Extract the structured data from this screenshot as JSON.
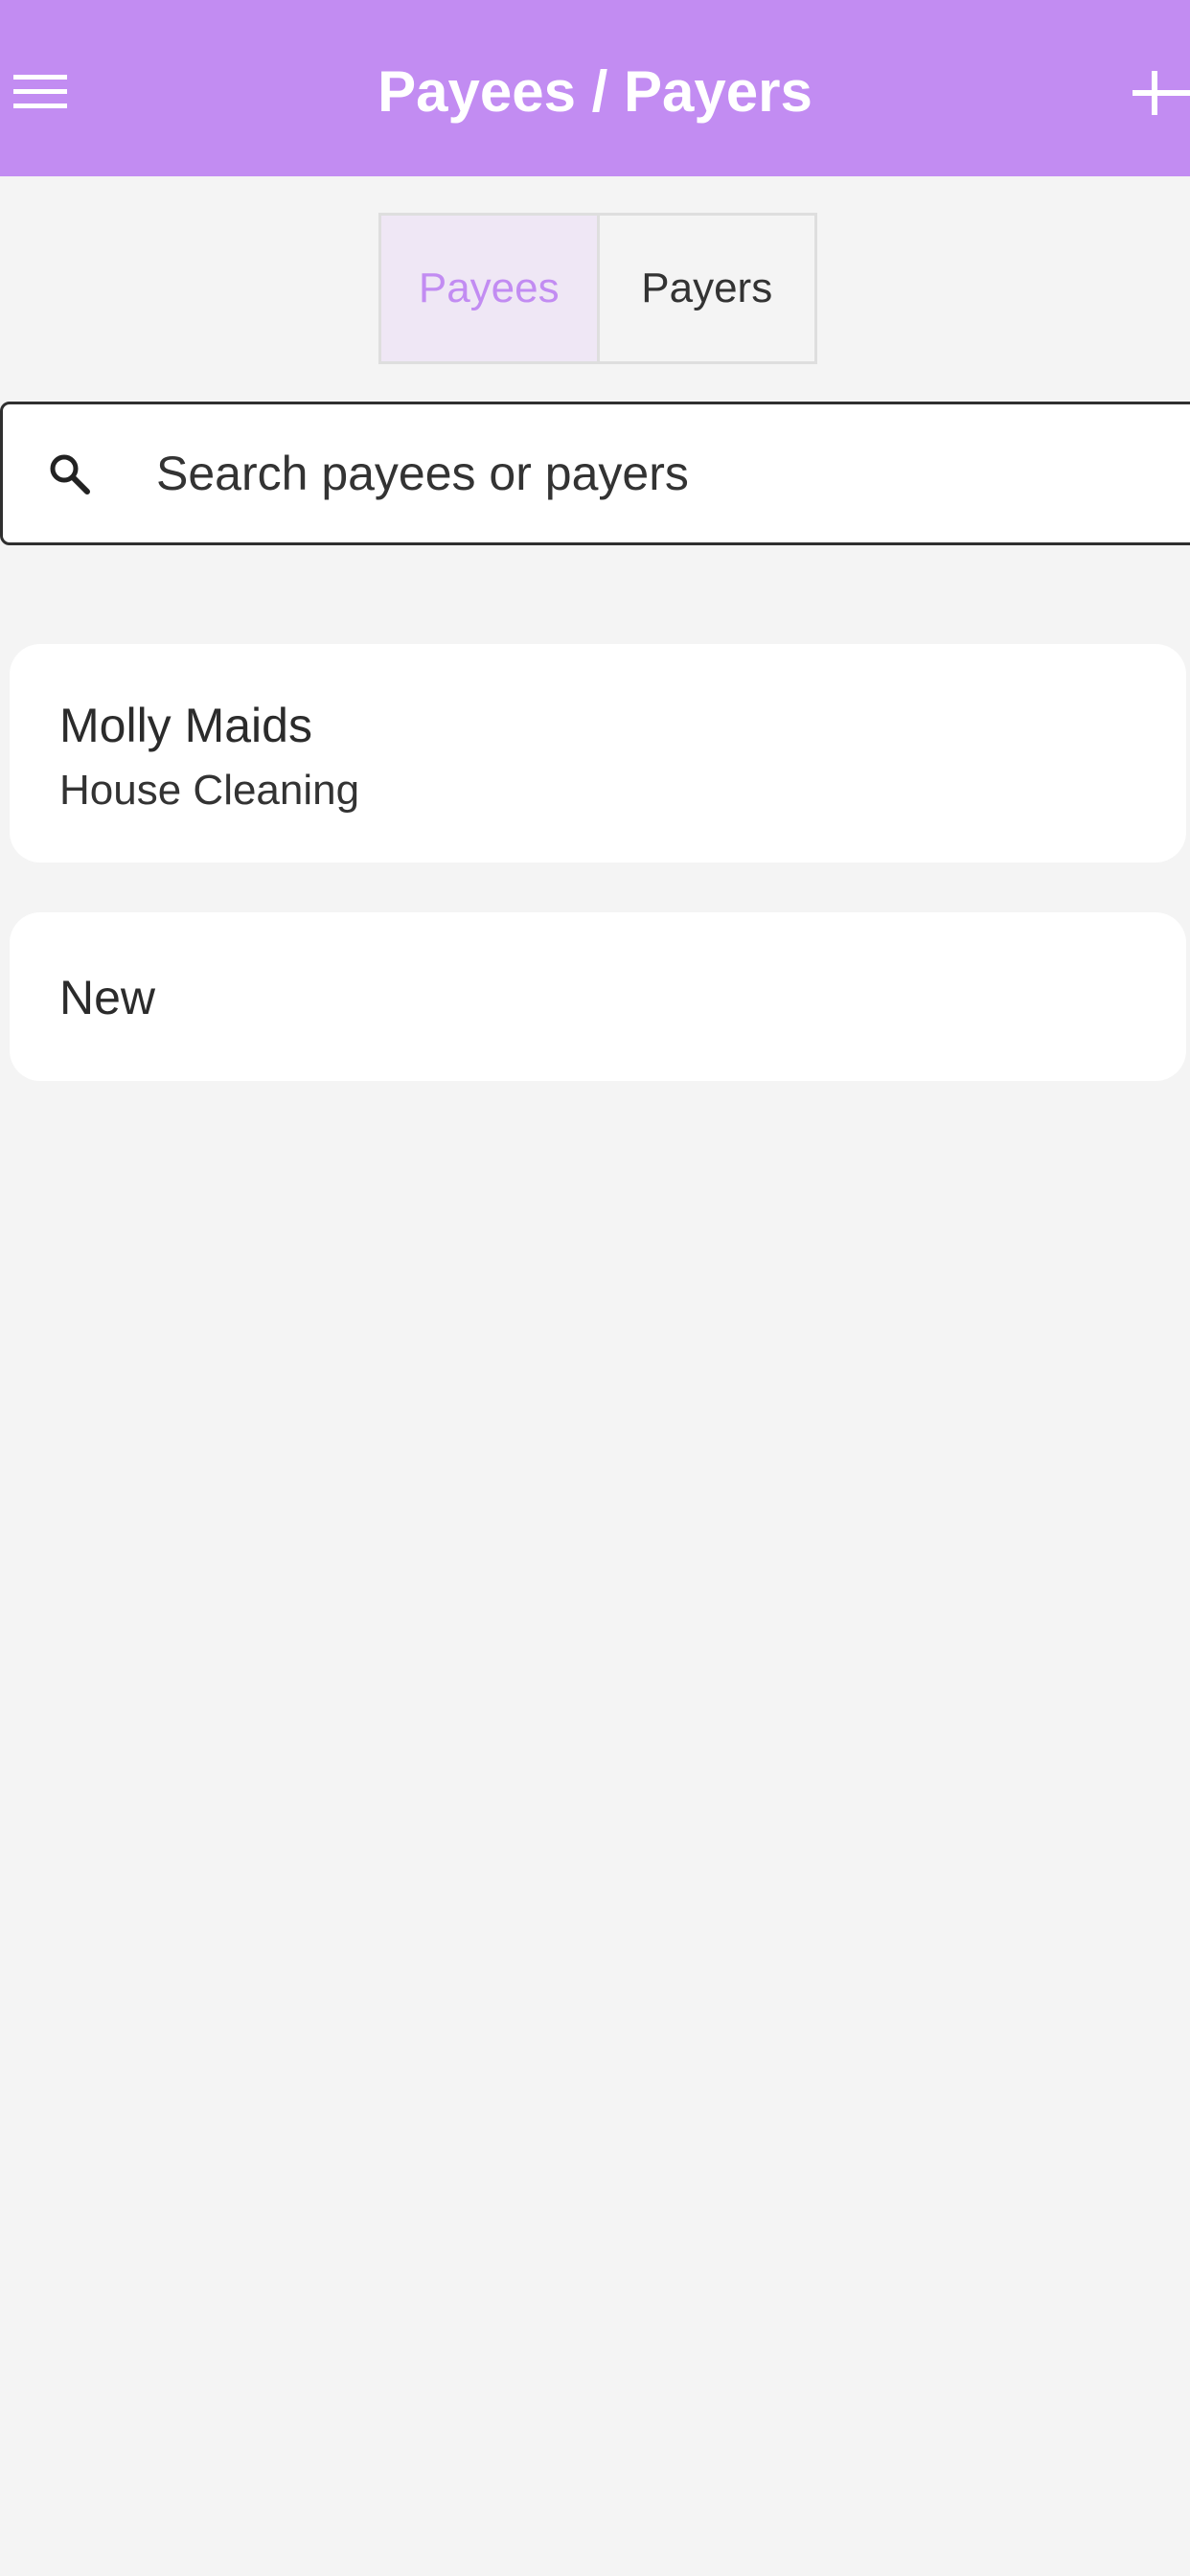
{
  "app_bar": {
    "title": "Payees / Payers",
    "menu_icon": "hamburger-menu-icon",
    "add_icon": "plus-icon",
    "background_color": "#c28cf2"
  },
  "tabs": [
    {
      "label": "Payees",
      "selected": true
    },
    {
      "label": "Payers",
      "selected": false
    }
  ],
  "search": {
    "placeholder": "Search payees or payers",
    "value": "",
    "icon": "search-icon"
  },
  "list": [
    {
      "title": "Molly Maids",
      "subtitle": "House Cleaning"
    },
    {
      "title": "New"
    }
  ],
  "colors": {
    "accent": "#c28cf2",
    "selected_tab_bg": "#efe7f5",
    "page_bg": "#f4f4f4"
  }
}
